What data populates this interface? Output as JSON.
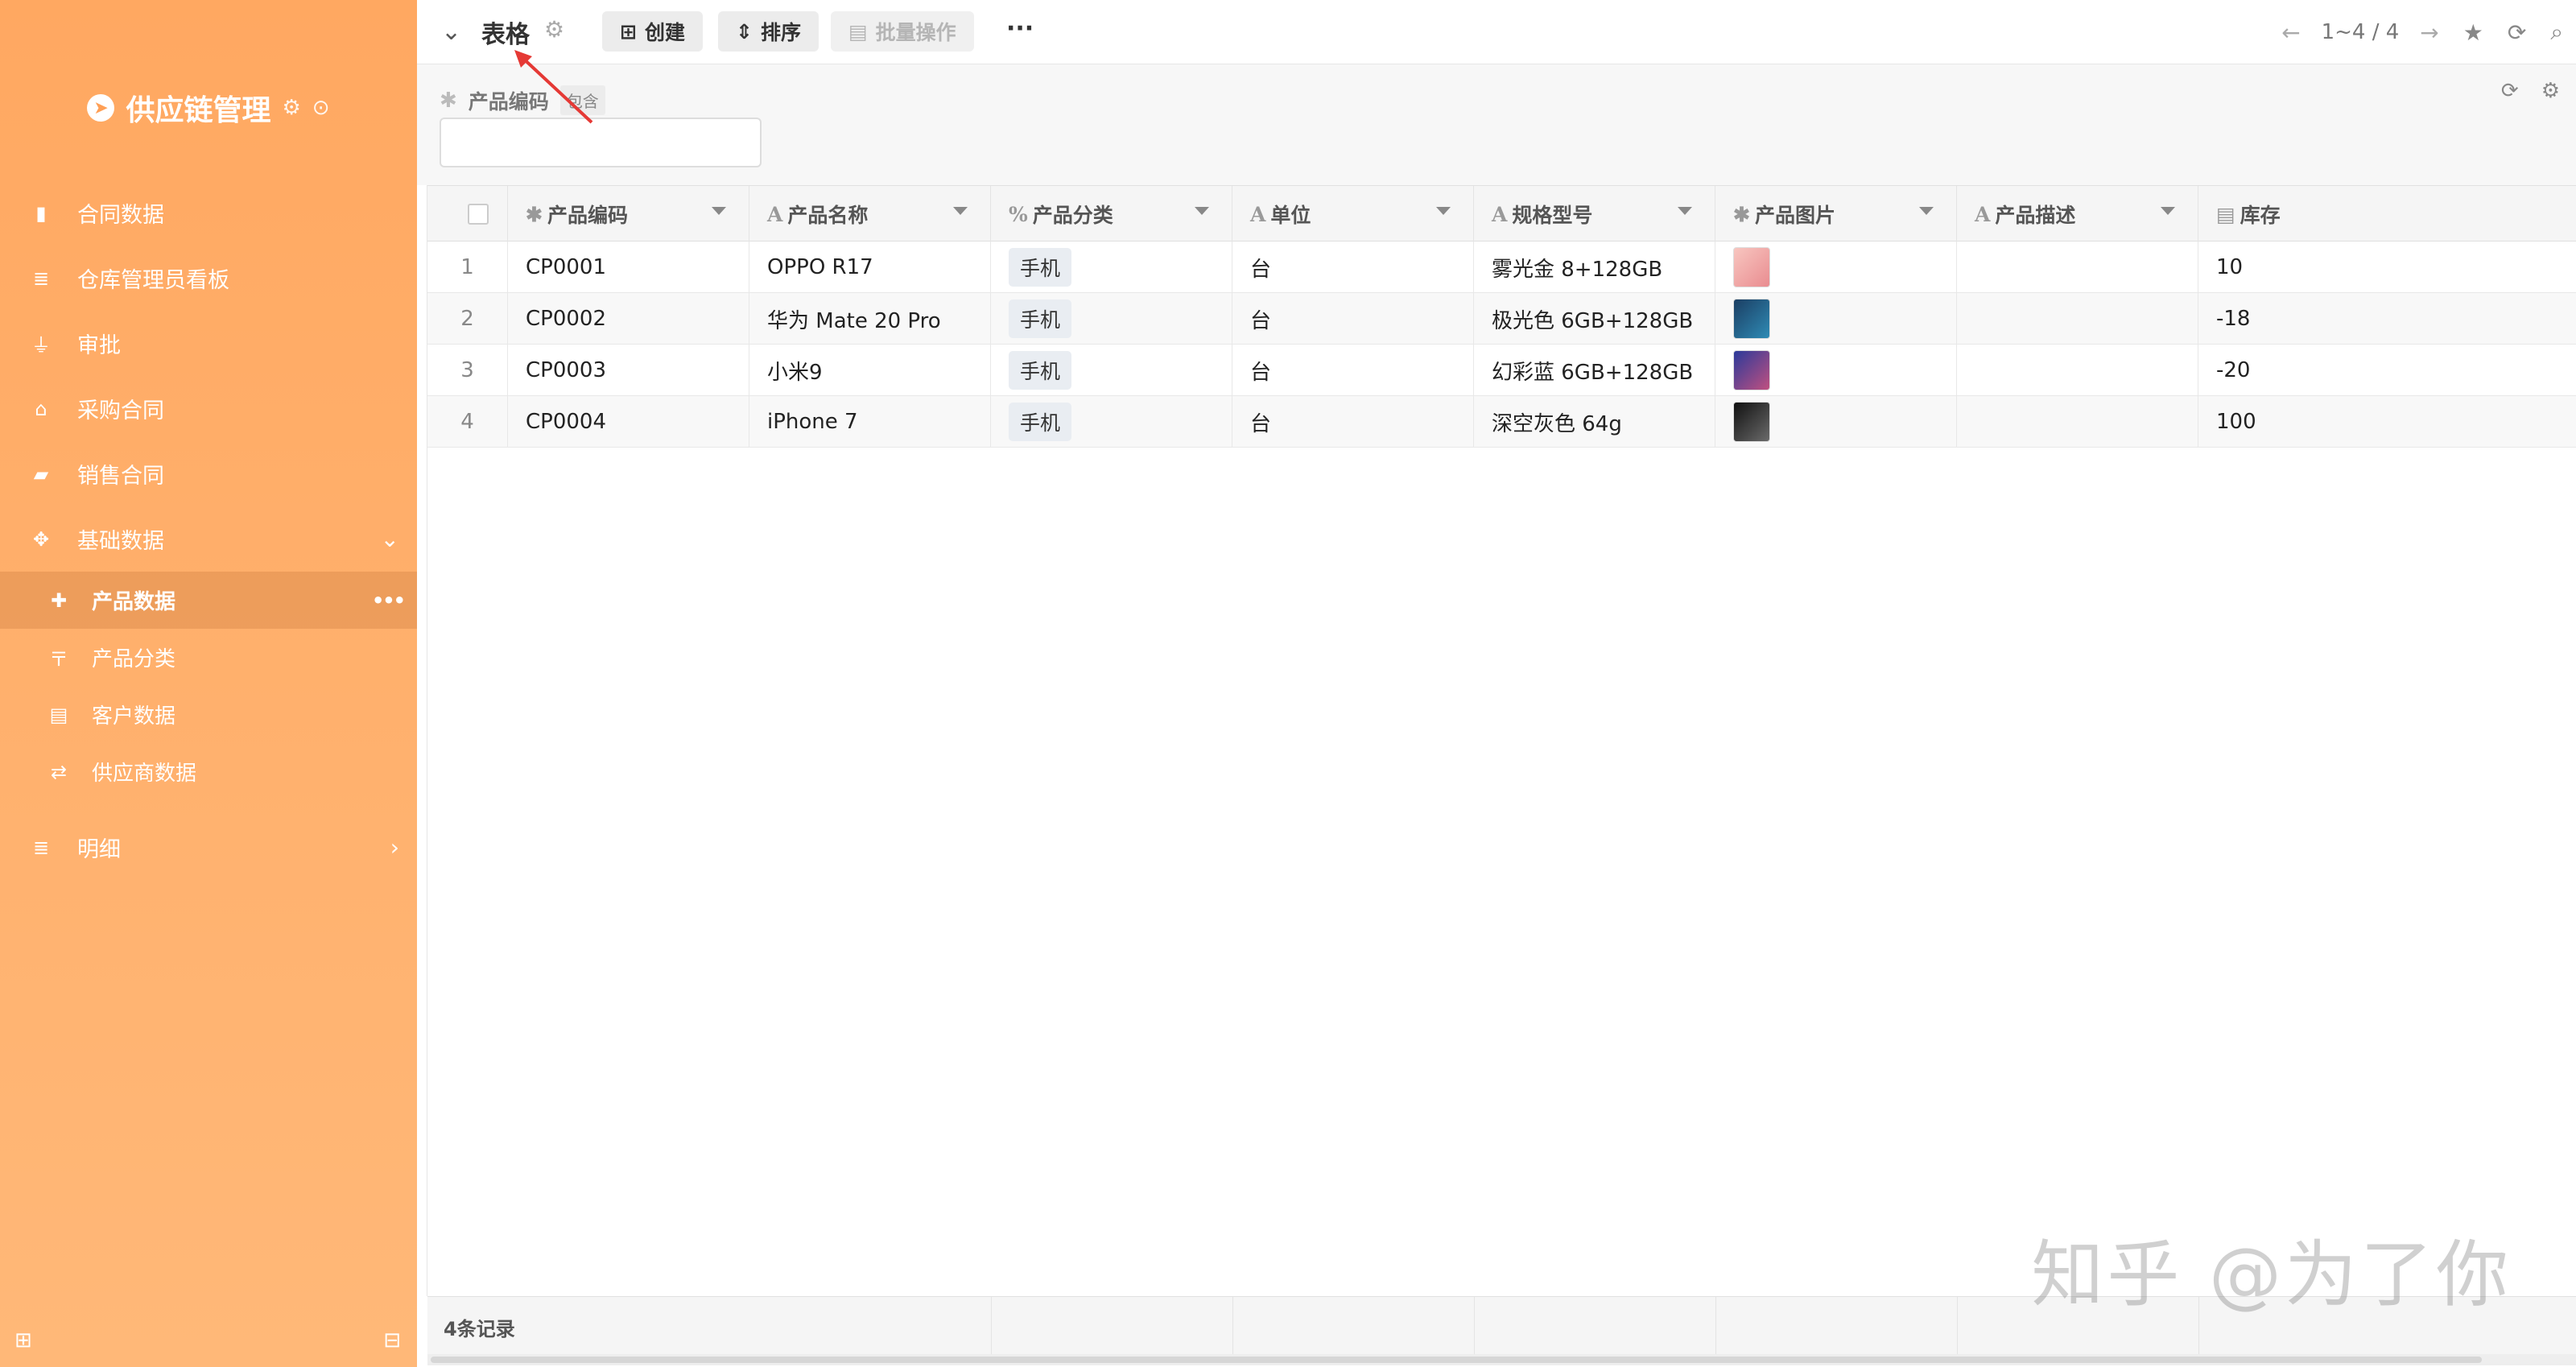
{
  "sidebar": {
    "app_title": "供应链管理",
    "nav": [
      {
        "label": "合同数据",
        "icon": "briefcase-icon"
      },
      {
        "label": "仓库管理员看板",
        "icon": "list-icon"
      },
      {
        "label": "审批",
        "icon": "stamp-icon"
      },
      {
        "label": "采购合同",
        "icon": "basket-icon"
      },
      {
        "label": "销售合同",
        "icon": "book-icon"
      },
      {
        "label": "基础数据",
        "icon": "crosshair-icon"
      }
    ],
    "sub": [
      {
        "label": "产品数据",
        "icon": "puzzle-icon",
        "active": true
      },
      {
        "label": "产品分类",
        "icon": "signpost-icon"
      },
      {
        "label": "客户数据",
        "icon": "id-card-icon"
      },
      {
        "label": "供应商数据",
        "icon": "exchange-icon"
      }
    ],
    "detail": {
      "label": "明细",
      "icon": "list-icon"
    }
  },
  "toolbar": {
    "title": "表格",
    "create_label": "创建",
    "sort_label": "排序",
    "batch_label": "批量操作",
    "more_label": "···",
    "pager_text": "1~4 / 4"
  },
  "filter": {
    "field_label": "产品编码",
    "operator": "包含",
    "value": ""
  },
  "columns": [
    {
      "label": "产品编码",
      "type_icon": "✱"
    },
    {
      "label": "产品名称",
      "type_icon": "A"
    },
    {
      "label": "产品分类",
      "type_icon": "%"
    },
    {
      "label": "单位",
      "type_icon": "A"
    },
    {
      "label": "规格型号",
      "type_icon": "A"
    },
    {
      "label": "产品图片",
      "type_icon": "✱"
    },
    {
      "label": "产品描述",
      "type_icon": "A"
    },
    {
      "label": "库存",
      "type_icon": "▤"
    }
  ],
  "rows": [
    {
      "idx": "1",
      "code": "CP0001",
      "name": "OPPO R17",
      "category": "手机",
      "unit": "台",
      "spec": "雾光金 8+128GB",
      "image_color": "#f4a8a8",
      "desc": "",
      "stock": "10"
    },
    {
      "idx": "2",
      "code": "CP0002",
      "name": "华为 Mate 20 Pro",
      "category": "手机",
      "unit": "台",
      "spec": "极光色 6GB+128GB",
      "image_color": "#1e5a8c",
      "desc": "",
      "stock": "-18"
    },
    {
      "idx": "3",
      "code": "CP0003",
      "name": "小米9",
      "category": "手机",
      "unit": "台",
      "spec": "幻彩蓝 6GB+128GB",
      "image_color": "#3a4bb0",
      "desc": "",
      "stock": "-20"
    },
    {
      "idx": "4",
      "code": "CP0004",
      "name": "iPhone 7",
      "category": "手机",
      "unit": "台",
      "spec": "深空灰色 64g",
      "image_color": "#2a2a2a",
      "desc": "",
      "stock": "100"
    }
  ],
  "footer": {
    "record_count": "4条记录"
  },
  "watermark": "知乎 @为了你"
}
